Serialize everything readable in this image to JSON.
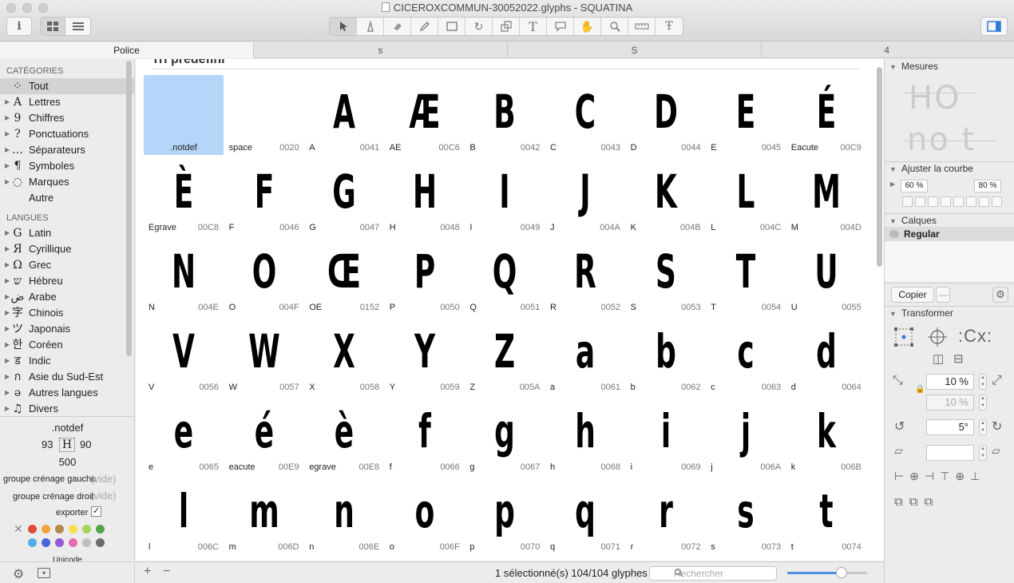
{
  "window": {
    "title": "CICEROXCOMMUN-30052022.glyphs - SQUATINA"
  },
  "toolbar": {
    "info_icon": "info-icon",
    "tools": [
      "select-icon",
      "pen-icon",
      "eraser-icon",
      "pencil-icon",
      "rectangle-icon",
      "rotate-icon",
      "scale-icon",
      "text-icon",
      "annotation-icon",
      "hand-icon",
      "zoom-icon",
      "measure-icon",
      "type-tool-icon"
    ]
  },
  "tabs": [
    {
      "label": "Police",
      "active": true
    },
    {
      "label": "s",
      "active": false
    },
    {
      "label": "S",
      "active": false
    },
    {
      "label": "4",
      "active": false
    }
  ],
  "sidebar": {
    "categories_title": "CATÉGORIES",
    "categories": [
      {
        "icon": "⁘",
        "label": "Tout",
        "selected": true,
        "arrow": false
      },
      {
        "icon": "A",
        "label": "Lettres",
        "arrow": true
      },
      {
        "icon": "9",
        "label": "Chiffres",
        "arrow": true
      },
      {
        "icon": "?",
        "label": "Ponctuations",
        "arrow": true
      },
      {
        "icon": "…",
        "label": "Séparateurs",
        "arrow": true
      },
      {
        "icon": "¶",
        "label": "Symboles",
        "arrow": true
      },
      {
        "icon": "◌",
        "label": "Marques",
        "arrow": true
      },
      {
        "icon": "",
        "label": "Autre",
        "arrow": false
      }
    ],
    "languages_title": "LANGUES",
    "languages": [
      {
        "icon": "G",
        "label": "Latin"
      },
      {
        "icon": "Я",
        "label": "Cyrillique"
      },
      {
        "icon": "Ω",
        "label": "Grec"
      },
      {
        "icon": "ש",
        "label": "Hébreu"
      },
      {
        "icon": "ض",
        "label": "Arabe"
      },
      {
        "icon": "字",
        "label": "Chinois"
      },
      {
        "icon": "ツ",
        "label": "Japonais"
      },
      {
        "icon": "한",
        "label": "Coréen"
      },
      {
        "icon": "ड",
        "label": "Indic"
      },
      {
        "icon": "ก",
        "label": "Asie du Sud-Est"
      },
      {
        "icon": "ə",
        "label": "Autres langues"
      },
      {
        "icon": "♫",
        "label": "Divers"
      }
    ]
  },
  "info": {
    "glyph_name": ".notdef",
    "lsb": "93",
    "rsb": "90",
    "width": "500",
    "kern_left_label": "groupe crénage gauche",
    "kern_left_value": "(vide)",
    "kern_right_label": "groupe crénage droit",
    "kern_right_value": "(vide)",
    "export_label": "exporter",
    "unicode_label": "Unicode",
    "colors": [
      "#e04b3a",
      "#f2a23c",
      "#b48a4c",
      "#f5e04a",
      "#a4d65a",
      "#4fa34a",
      "#52aee6",
      "#4a63d9",
      "#9a59d1",
      "#e66cb4",
      "#bfbfbf",
      "#6b6b6b"
    ]
  },
  "grid": {
    "section_title": "Tri prédéfini",
    "glyphs": [
      {
        "g": "",
        "n": ".notdef",
        "u": "",
        "sel": true
      },
      {
        "g": "",
        "n": "space",
        "u": "0020"
      },
      {
        "g": "A",
        "n": "A",
        "u": "0041"
      },
      {
        "g": "Æ",
        "n": "AE",
        "u": "00C6"
      },
      {
        "g": "B",
        "n": "B",
        "u": "0042"
      },
      {
        "g": "C",
        "n": "C",
        "u": "0043"
      },
      {
        "g": "D",
        "n": "D",
        "u": "0044"
      },
      {
        "g": "E",
        "n": "E",
        "u": "0045"
      },
      {
        "g": "É",
        "n": "Eacute",
        "u": "00C9"
      },
      {
        "g": "È",
        "n": "Egrave",
        "u": "00C8"
      },
      {
        "g": "F",
        "n": "F",
        "u": "0046"
      },
      {
        "g": "G",
        "n": "G",
        "u": "0047"
      },
      {
        "g": "H",
        "n": "H",
        "u": "0048"
      },
      {
        "g": "I",
        "n": "I",
        "u": "0049"
      },
      {
        "g": "J",
        "n": "J",
        "u": "004A"
      },
      {
        "g": "K",
        "n": "K",
        "u": "004B"
      },
      {
        "g": "L",
        "n": "L",
        "u": "004C"
      },
      {
        "g": "M",
        "n": "M",
        "u": "004D"
      },
      {
        "g": "N",
        "n": "N",
        "u": "004E"
      },
      {
        "g": "O",
        "n": "O",
        "u": "004F"
      },
      {
        "g": "Œ",
        "n": "OE",
        "u": "0152"
      },
      {
        "g": "P",
        "n": "P",
        "u": "0050"
      },
      {
        "g": "Q",
        "n": "Q",
        "u": "0051"
      },
      {
        "g": "R",
        "n": "R",
        "u": "0052"
      },
      {
        "g": "S",
        "n": "S",
        "u": "0053"
      },
      {
        "g": "T",
        "n": "T",
        "u": "0054"
      },
      {
        "g": "U",
        "n": "U",
        "u": "0055"
      },
      {
        "g": "V",
        "n": "V",
        "u": "0056"
      },
      {
        "g": "W",
        "n": "W",
        "u": "0057"
      },
      {
        "g": "X",
        "n": "X",
        "u": "0058"
      },
      {
        "g": "Y",
        "n": "Y",
        "u": "0059"
      },
      {
        "g": "Z",
        "n": "Z",
        "u": "005A"
      },
      {
        "g": "a",
        "n": "a",
        "u": "0061"
      },
      {
        "g": "b",
        "n": "b",
        "u": "0062"
      },
      {
        "g": "c",
        "n": "c",
        "u": "0063"
      },
      {
        "g": "d",
        "n": "d",
        "u": "0064"
      },
      {
        "g": "e",
        "n": "e",
        "u": "0065"
      },
      {
        "g": "é",
        "n": "eacute",
        "u": "00E9"
      },
      {
        "g": "è",
        "n": "egrave",
        "u": "00E8"
      },
      {
        "g": "f",
        "n": "f",
        "u": "0066"
      },
      {
        "g": "g",
        "n": "g",
        "u": "0067"
      },
      {
        "g": "h",
        "n": "h",
        "u": "0068"
      },
      {
        "g": "i",
        "n": "i",
        "u": "0069"
      },
      {
        "g": "j",
        "n": "j",
        "u": "006A"
      },
      {
        "g": "k",
        "n": "k",
        "u": "006B"
      },
      {
        "g": "l",
        "n": "l",
        "u": "006C"
      },
      {
        "g": "m",
        "n": "m",
        "u": "006D"
      },
      {
        "g": "n",
        "n": "n",
        "u": "006E"
      },
      {
        "g": "o",
        "n": "o",
        "u": "006F"
      },
      {
        "g": "p",
        "n": "p",
        "u": "0070"
      },
      {
        "g": "q",
        "n": "q",
        "u": "0071"
      },
      {
        "g": "r",
        "n": "r",
        "u": "0072"
      },
      {
        "g": "s",
        "n": "s",
        "u": "0073"
      },
      {
        "g": "t",
        "n": "t",
        "u": "0074"
      }
    ]
  },
  "statusbar": {
    "status": "1 sélectionné(s) 104/104 glyphes",
    "search_placeholder": "Rechercher",
    "zoom_level": 0.68
  },
  "panel": {
    "measures_title": "Mesures",
    "preview_upper": "HO",
    "preview_lower": "no t",
    "curve_title": "Ajuster la courbe",
    "curve_left": "60 %",
    "curve_right": "80 %",
    "layers_title": "Calques",
    "layer_name": "Regular",
    "copy_label": "Copier",
    "transform_title": "Transformer",
    "scale_value": "10 %",
    "scale_value2": "10 %",
    "rotate_value": "5°",
    "slant_value": ""
  }
}
